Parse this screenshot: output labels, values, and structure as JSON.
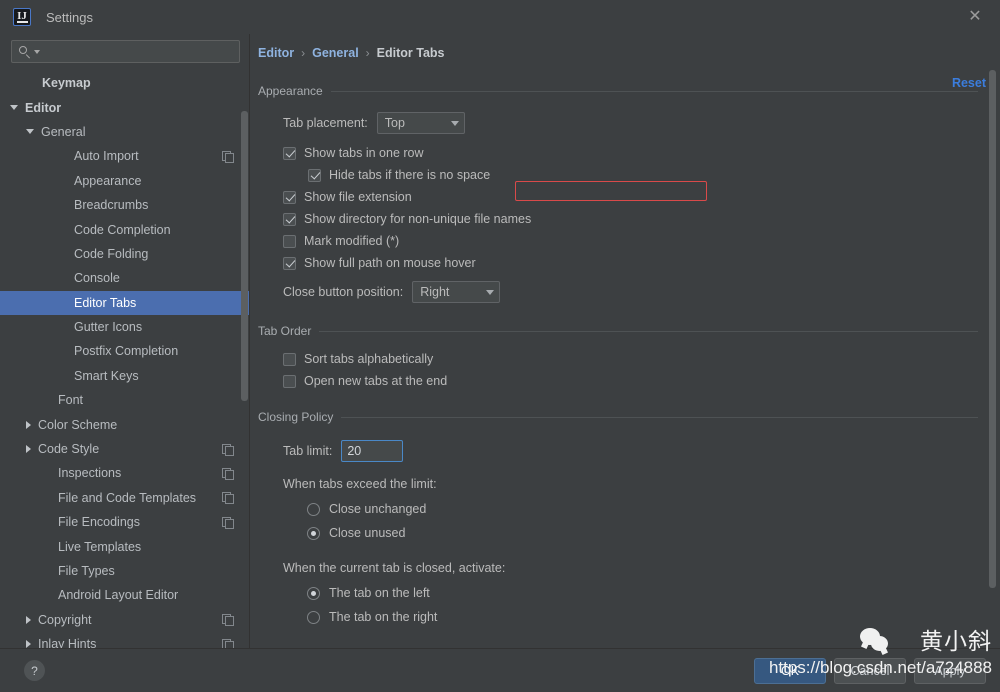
{
  "window": {
    "title": "Settings",
    "app_icon": "intellij-idea-icon",
    "close_icon": "close-icon"
  },
  "sidebar": {
    "search": {
      "value": "",
      "placeholder": "",
      "icon": "search-icon"
    },
    "items": [
      {
        "label": "Keymap",
        "indent": 1,
        "arrow": "none",
        "bold": true,
        "selected": false,
        "badge": false
      },
      {
        "label": "Editor",
        "indent": 0,
        "arrow": "down",
        "bold": true,
        "selected": false,
        "badge": false
      },
      {
        "label": "General",
        "indent": 1,
        "arrow": "down",
        "bold": false,
        "selected": false,
        "badge": false
      },
      {
        "label": "Auto Import",
        "indent": 3,
        "arrow": "none",
        "bold": false,
        "selected": false,
        "badge": true
      },
      {
        "label": "Appearance",
        "indent": 3,
        "arrow": "none",
        "bold": false,
        "selected": false,
        "badge": false
      },
      {
        "label": "Breadcrumbs",
        "indent": 3,
        "arrow": "none",
        "bold": false,
        "selected": false,
        "badge": false
      },
      {
        "label": "Code Completion",
        "indent": 3,
        "arrow": "none",
        "bold": false,
        "selected": false,
        "badge": false
      },
      {
        "label": "Code Folding",
        "indent": 3,
        "arrow": "none",
        "bold": false,
        "selected": false,
        "badge": false
      },
      {
        "label": "Console",
        "indent": 3,
        "arrow": "none",
        "bold": false,
        "selected": false,
        "badge": false
      },
      {
        "label": "Editor Tabs",
        "indent": 3,
        "arrow": "none",
        "bold": false,
        "selected": true,
        "badge": false
      },
      {
        "label": "Gutter Icons",
        "indent": 3,
        "arrow": "none",
        "bold": false,
        "selected": false,
        "badge": false
      },
      {
        "label": "Postfix Completion",
        "indent": 3,
        "arrow": "none",
        "bold": false,
        "selected": false,
        "badge": false
      },
      {
        "label": "Smart Keys",
        "indent": 3,
        "arrow": "none",
        "bold": false,
        "selected": false,
        "badge": false
      },
      {
        "label": "Font",
        "indent": 2,
        "arrow": "none",
        "bold": false,
        "selected": false,
        "badge": false
      },
      {
        "label": "Color Scheme",
        "indent": 1,
        "arrow": "right",
        "bold": false,
        "selected": false,
        "badge": false
      },
      {
        "label": "Code Style",
        "indent": 1,
        "arrow": "right",
        "bold": false,
        "selected": false,
        "badge": true
      },
      {
        "label": "Inspections",
        "indent": 2,
        "arrow": "none",
        "bold": false,
        "selected": false,
        "badge": true
      },
      {
        "label": "File and Code Templates",
        "indent": 2,
        "arrow": "none",
        "bold": false,
        "selected": false,
        "badge": true
      },
      {
        "label": "File Encodings",
        "indent": 2,
        "arrow": "none",
        "bold": false,
        "selected": false,
        "badge": true
      },
      {
        "label": "Live Templates",
        "indent": 2,
        "arrow": "none",
        "bold": false,
        "selected": false,
        "badge": false
      },
      {
        "label": "File Types",
        "indent": 2,
        "arrow": "none",
        "bold": false,
        "selected": false,
        "badge": false
      },
      {
        "label": "Android Layout Editor",
        "indent": 2,
        "arrow": "none",
        "bold": false,
        "selected": false,
        "badge": false
      },
      {
        "label": "Copyright",
        "indent": 1,
        "arrow": "right",
        "bold": false,
        "selected": false,
        "badge": true
      },
      {
        "label": "Inlay Hints",
        "indent": 1,
        "arrow": "right",
        "bold": false,
        "selected": false,
        "badge": true
      }
    ]
  },
  "main": {
    "breadcrumb": [
      "Editor",
      "General",
      "Editor Tabs"
    ],
    "breadcrumb_separator": "›",
    "reset_label": "Reset",
    "appearance": {
      "group_title": "Appearance",
      "tab_placement_label": "Tab placement:",
      "tab_placement_value": "Top",
      "checkboxes": [
        {
          "label": "Show tabs in one row",
          "checked": true,
          "indent": 0,
          "highlighted": true
        },
        {
          "label": "Hide tabs if there is no space",
          "checked": true,
          "indent": 1,
          "highlighted": false
        },
        {
          "label": "Show file extension",
          "checked": true,
          "indent": 0,
          "highlighted": false
        },
        {
          "label": "Show directory for non-unique file names",
          "checked": true,
          "indent": 0,
          "highlighted": false
        },
        {
          "label": "Mark modified (*)",
          "checked": false,
          "indent": 0,
          "highlighted": false
        },
        {
          "label": "Show full path on mouse hover",
          "checked": true,
          "indent": 0,
          "highlighted": false
        }
      ],
      "close_button_label": "Close button position:",
      "close_button_value": "Right"
    },
    "tab_order": {
      "group_title": "Tab Order",
      "checkboxes": [
        {
          "label": "Sort tabs alphabetically",
          "checked": false
        },
        {
          "label": "Open new tabs at the end",
          "checked": false
        }
      ]
    },
    "closing_policy": {
      "group_title": "Closing Policy",
      "tab_limit_label": "Tab limit:",
      "tab_limit_value": "20",
      "exceed_label": "When tabs exceed the limit:",
      "exceed_options": [
        {
          "label": "Close unchanged",
          "checked": false
        },
        {
          "label": "Close unused",
          "checked": true
        }
      ],
      "activate_label": "When the current tab is closed, activate:",
      "activate_options": [
        {
          "label": "The tab on the left",
          "checked": true
        },
        {
          "label": "The tab on the right",
          "checked": false
        }
      ]
    }
  },
  "footer": {
    "help_label": "?",
    "buttons": [
      {
        "label": "OK",
        "primary": true
      },
      {
        "label": "Cancel",
        "primary": false
      },
      {
        "label": "Apply",
        "primary": false
      }
    ]
  },
  "watermark": {
    "name": "黄小斜",
    "url": "https://blog.csdn.net/a724888",
    "logo": "wechat-logo"
  },
  "colors": {
    "accent_selection": "#4b6eaf",
    "link": "#3b7ddd",
    "highlight_outline": "#d94a4a",
    "panel_bg": "#3c3f41",
    "field_bg": "#45494a"
  }
}
